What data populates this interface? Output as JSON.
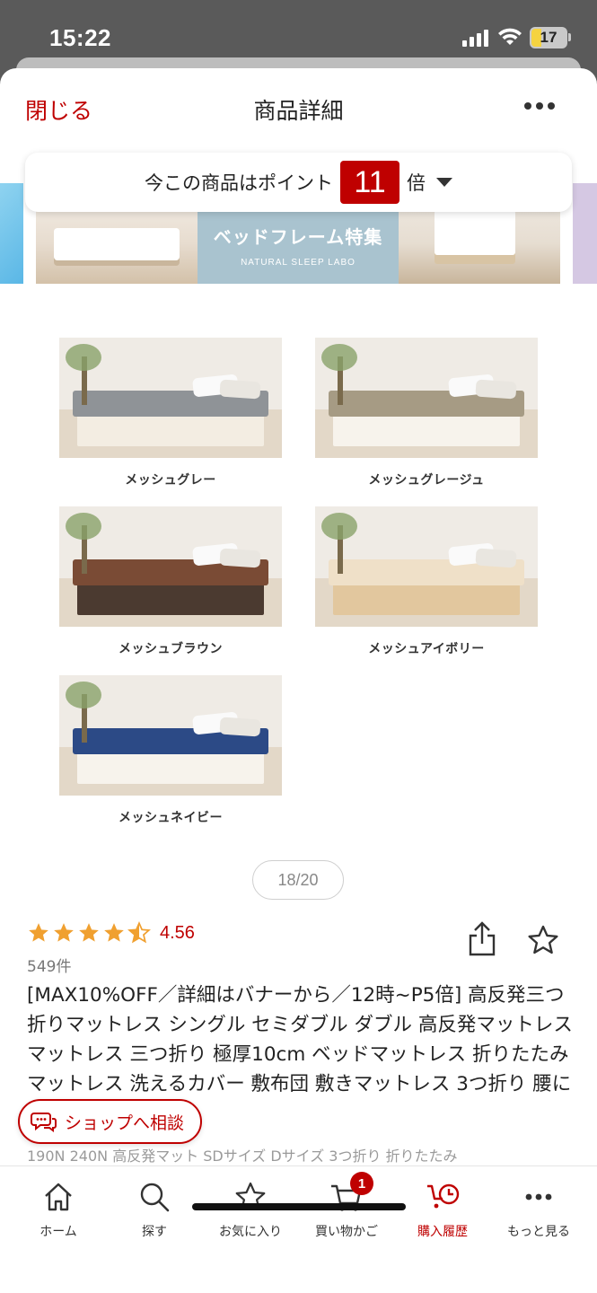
{
  "status_bar": {
    "time": "15:22",
    "battery": "17"
  },
  "header": {
    "close_label": "閉じる",
    "title": "商品詳細"
  },
  "points": {
    "prefix": "今この商品はポイント",
    "multiplier": "11",
    "suffix": "倍"
  },
  "banner": {
    "headline": "ベッドフレーム特集",
    "brand": "NATURAL SLEEP LABO"
  },
  "variants": [
    {
      "label": "メッシュグレー",
      "color": "#8f9397"
    },
    {
      "label": "メッシュグレージュ",
      "color": "#a69b84"
    },
    {
      "label": "メッシュブラウン",
      "color": "#7a4b35"
    },
    {
      "label": "メッシュアイボリー",
      "color": "#efe0c8"
    },
    {
      "label": "メッシュネイビー",
      "color": "#2c4a86"
    }
  ],
  "pager": {
    "text": "18/20"
  },
  "rating": {
    "value": "4.56",
    "stars": 4.5,
    "count": "549件"
  },
  "product": {
    "title": "[MAX10%OFF／詳細はバナーから／12時~P5倍] 高反発三つ折りマットレス シングル セミダブル ダブル 高反発マットレス マットレス 三つ折り 極厚10cm ベッドマットレス 折りたたみマットレス 洗えるカバー 敷布団 敷きマットレス 3つ折り 腰に優しい",
    "subtitle": "190N 240N 高反発マット SDサイズ Dサイズ 3つ折り 折りたたみ"
  },
  "consult_button": {
    "label": "ショップへ相談"
  },
  "tabbar": {
    "home": "ホーム",
    "search": "探す",
    "favorites": "お気に入り",
    "cart": "買い物かご",
    "cart_badge": "1",
    "history": "購入履歴",
    "more": "もっと見る"
  },
  "colors": {
    "accent": "#bf0000",
    "star": "#f0a030"
  }
}
